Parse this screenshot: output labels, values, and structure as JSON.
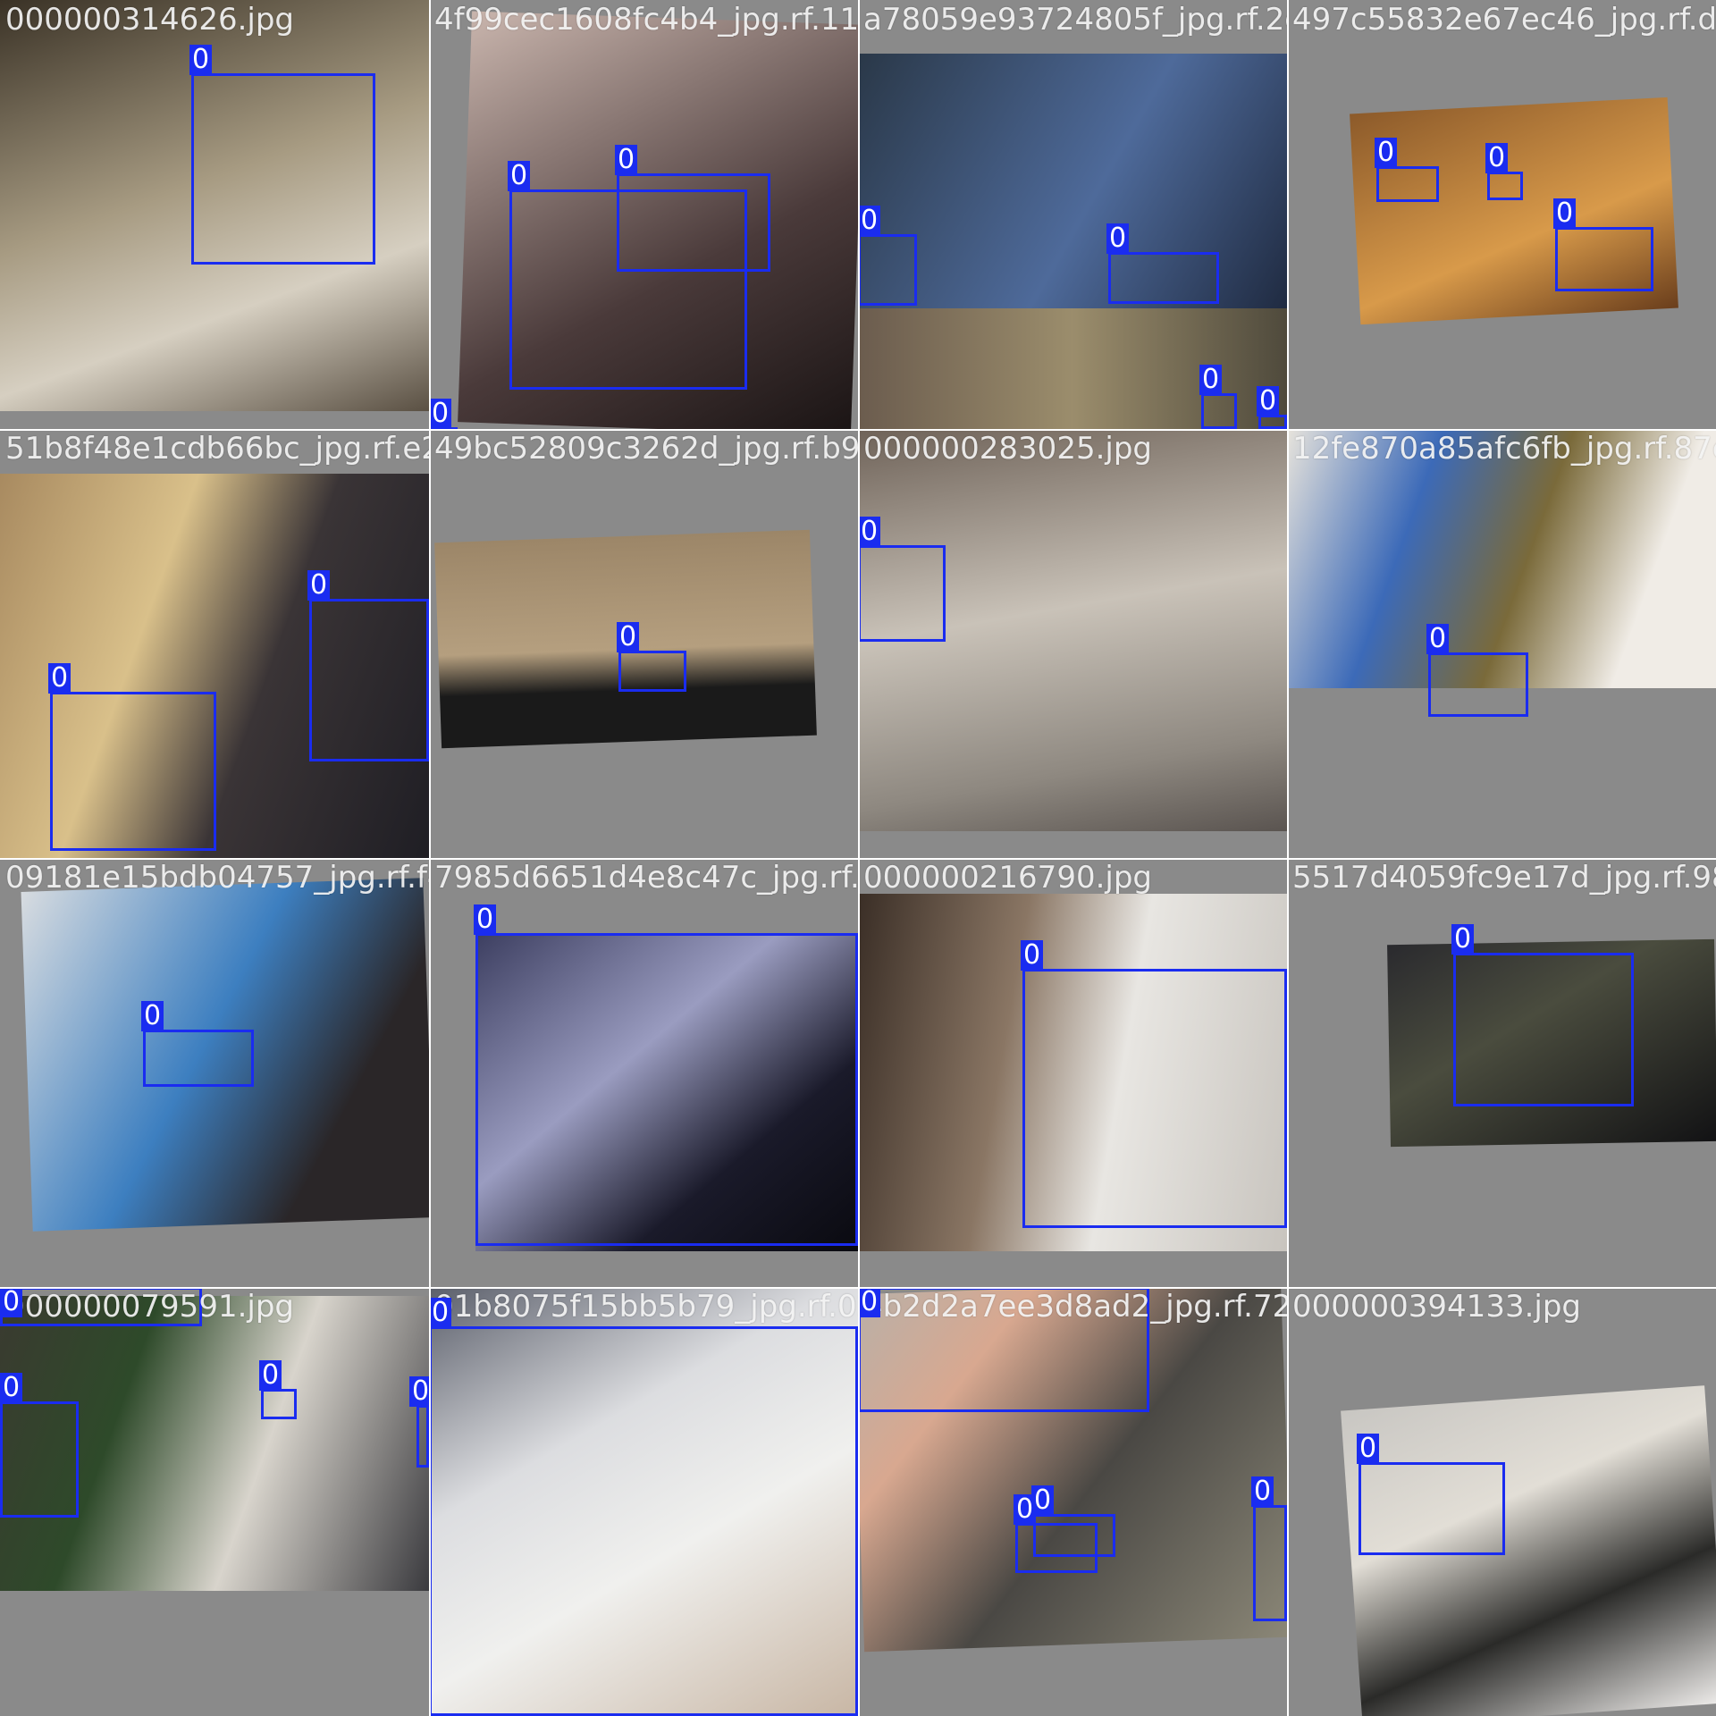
{
  "mosaic": {
    "tiles": [
      {
        "filename": "000000314626.jpg",
        "boxes": [
          {
            "label": "0"
          }
        ]
      },
      {
        "filename": "4f99cec1608fc4b4_jpg.rf.115f...",
        "boxes": [
          {
            "label": "0"
          },
          {
            "label": "0"
          },
          {
            "label": "0"
          }
        ]
      },
      {
        "filename": "a78059e93724805f_jpg.rf.2d0...",
        "boxes": [
          {
            "label": "0"
          },
          {
            "label": "0"
          },
          {
            "label": "0"
          },
          {
            "label": "0"
          }
        ]
      },
      {
        "filename": "497c55832e67ec46_jpg.rf.dc...",
        "boxes": [
          {
            "label": "0"
          },
          {
            "label": "0"
          },
          {
            "label": "0"
          }
        ]
      },
      {
        "filename": "51b8f48e1cdb66bc_jpg.rf.e2...",
        "boxes": [
          {
            "label": "0"
          },
          {
            "label": "0"
          }
        ]
      },
      {
        "filename": "49bc52809c3262d_jpg.rf.b9f...",
        "boxes": [
          {
            "label": "0"
          }
        ]
      },
      {
        "filename": "000000283025.jpg",
        "boxes": [
          {
            "label": "0"
          }
        ]
      },
      {
        "filename": "12fe870a85afc6fb_jpg.rf.87e...",
        "boxes": [
          {
            "label": "0"
          }
        ]
      },
      {
        "filename": "09181e15bdb04757_jpg.rf.f4...",
        "boxes": [
          {
            "label": "0"
          }
        ]
      },
      {
        "filename": "7985d6651d4e8c47c_jpg.rf.47...",
        "boxes": [
          {
            "label": "0"
          }
        ]
      },
      {
        "filename": "000000216790.jpg",
        "boxes": [
          {
            "label": "0"
          }
        ]
      },
      {
        "filename": "5517d4059fc9e17d_jpg.rf.98...",
        "boxes": [
          {
            "label": "0"
          }
        ]
      },
      {
        "filename": "000000079591.jpg",
        "boxes": [
          {
            "label": "0"
          },
          {
            "label": "0"
          },
          {
            "label": "0"
          },
          {
            "label": "0"
          }
        ]
      },
      {
        "filename": "01b8075f15bb5b79_jpg.rf.02...",
        "boxes": [
          {
            "label": "0"
          }
        ]
      },
      {
        "filename": "4b2d2a7ee3d8ad2_jpg.rf.72...",
        "boxes": [
          {
            "label": "0"
          },
          {
            "label": "0"
          },
          {
            "label": "0"
          },
          {
            "label": "0"
          }
        ]
      },
      {
        "filename": "000000394133.jpg",
        "boxes": [
          {
            "label": "0"
          }
        ]
      }
    ]
  },
  "colors": {
    "box": "#1a2cf0",
    "label_text": "#ffffff",
    "filename_text": "#f4f4f4",
    "padding_gray": "#7f7f7f"
  }
}
